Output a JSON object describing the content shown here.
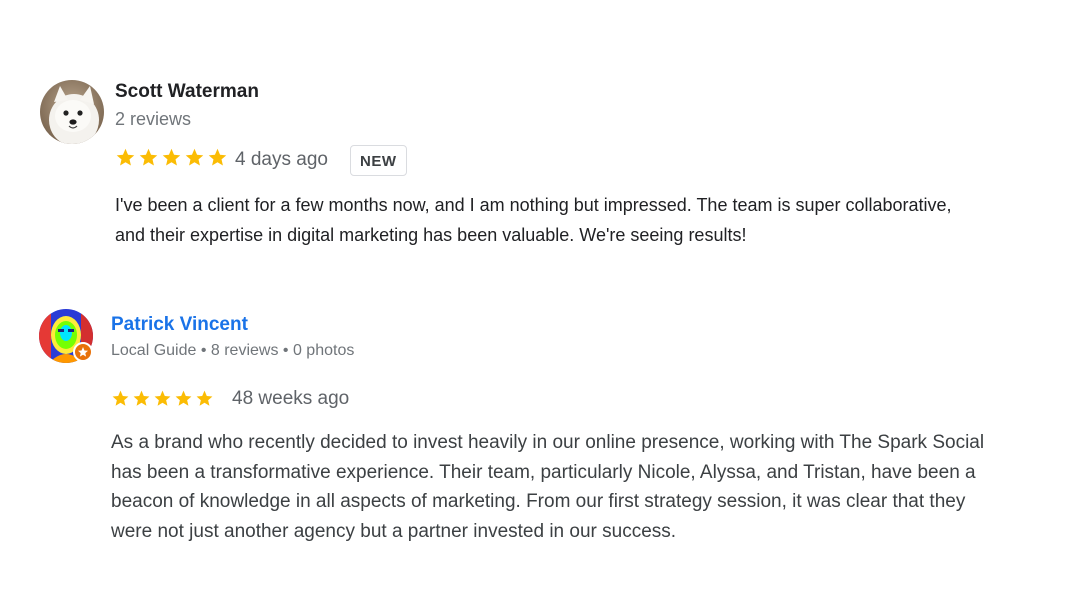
{
  "reviews": [
    {
      "author": "Scott Waterman",
      "meta": "2 reviews",
      "rating": 5,
      "date": "4 days ago",
      "badge": "NEW",
      "text": "I've been a client for a few months now, and I am nothing but impressed. The team is super collaborative, and their expertise in digital marketing has been valuable. We're seeing results!",
      "avatar_icon": "dog-photo"
    },
    {
      "author": "Patrick Vincent",
      "meta": "Local Guide • 8 reviews • 0 photos",
      "rating": 5,
      "date": "48 weeks ago",
      "text": "As a brand who recently decided to invest heavily in our online presence, working with The Spark Social has been a transformative experience. Their team, particularly Nicole, Alyssa, and Tristan, have been a beacon of knowledge in all aspects of marketing. From our first strategy session, it was clear that they were not just another agency but a partner invested in our success.",
      "avatar_icon": "thermal-portrait-photo"
    }
  ],
  "colors": {
    "star": "#fbbc04",
    "link_name": "#1a73e8",
    "local_guide_badge": "#e8710a"
  }
}
